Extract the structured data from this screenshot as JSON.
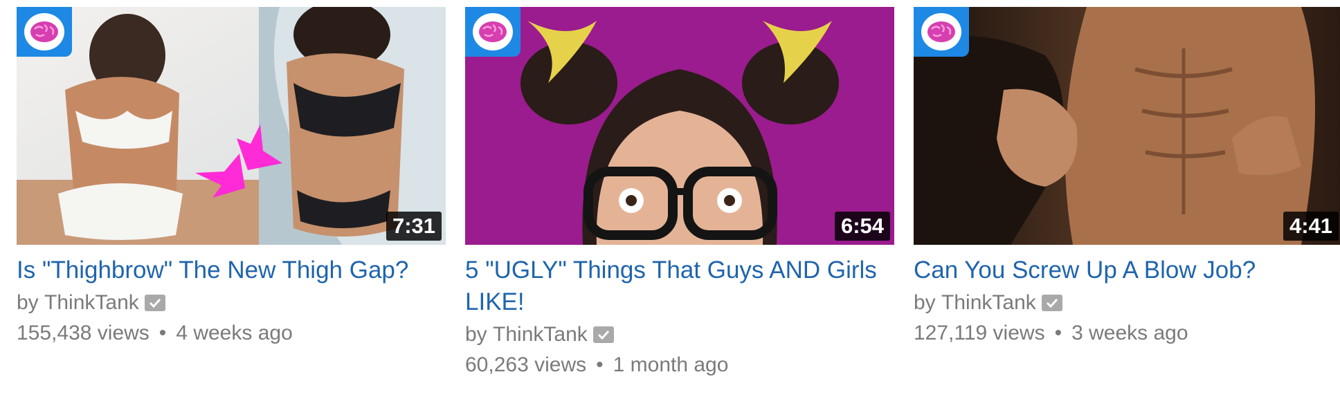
{
  "videos": [
    {
      "title": "Is \"Thighbrow\" The New Thigh Gap?",
      "channel_prefix": "by",
      "channel": "ThinkTank",
      "duration": "7:31",
      "views": "155,438 views",
      "age": "4 weeks ago"
    },
    {
      "title": "5 \"UGLY\" Things That Guys AND Girls LIKE!",
      "channel_prefix": "by",
      "channel": "ThinkTank",
      "duration": "6:54",
      "views": "60,263 views",
      "age": "1 month ago"
    },
    {
      "title": "Can You Screw Up A Blow Job?",
      "channel_prefix": "by",
      "channel": "ThinkTank",
      "duration": "4:41",
      "views": "127,119 views",
      "age": "3 weeks ago"
    }
  ],
  "separator": "•",
  "colors": {
    "title_link": "#1f64ad",
    "meta_text": "#7a7a7a",
    "badge_blue": "#1e88e5",
    "brain_pink": "#d63fb0",
    "thumb2_bg": "#9b1c8e"
  },
  "icons": [
    "brain-logo-icon",
    "verified-check-icon",
    "arrow-icon"
  ]
}
